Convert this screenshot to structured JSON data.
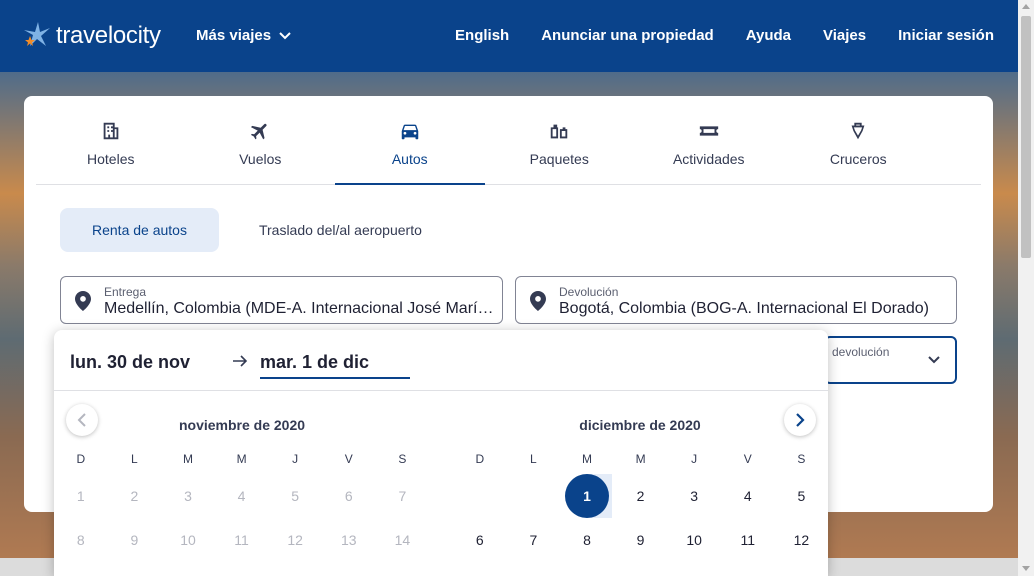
{
  "header": {
    "logo_text": "travelocity",
    "more_trips": "Más viajes",
    "nav": [
      "English",
      "Anunciar una propiedad",
      "Ayuda",
      "Viajes",
      "Iniciar sesión"
    ]
  },
  "tabs": [
    {
      "label": "Hoteles",
      "icon": "building-icon"
    },
    {
      "label": "Vuelos",
      "icon": "plane-icon"
    },
    {
      "label": "Autos",
      "icon": "car-icon",
      "active": true
    },
    {
      "label": "Paquetes",
      "icon": "luggage-icon"
    },
    {
      "label": "Actividades",
      "icon": "ticket-icon"
    },
    {
      "label": "Cruceros",
      "icon": "ship-icon"
    }
  ],
  "subtabs": {
    "rental": "Renta de autos",
    "transfer": "Traslado del/al aeropuerto"
  },
  "pickup": {
    "label": "Entrega",
    "value": "Medellín, Colombia (MDE-A. Internacional José María Córdova)"
  },
  "dropoff": {
    "label": "Devolución",
    "value": "Bogotá, Colombia (BOG-A. Internacional El Dorado)"
  },
  "return_time": {
    "label": "devolución"
  },
  "calendar": {
    "start_date": "lun. 30 de nov",
    "end_date": "mar. 1 de dic",
    "months": [
      {
        "title": "noviembre de 2020",
        "weekdays": [
          "D",
          "L",
          "M",
          "M",
          "J",
          "V",
          "S"
        ],
        "days": [
          "1",
          "2",
          "3",
          "4",
          "5",
          "6",
          "7",
          "8",
          "9",
          "10",
          "11",
          "12",
          "13",
          "14"
        ],
        "disabled": true
      },
      {
        "title": "diciembre de 2020",
        "weekdays": [
          "D",
          "L",
          "M",
          "M",
          "J",
          "V",
          "S"
        ],
        "leading_blanks": 2,
        "days": [
          "1",
          "2",
          "3",
          "4",
          "5",
          "6",
          "7",
          "8",
          "9",
          "10",
          "11",
          "12"
        ],
        "selected": "1"
      }
    ]
  },
  "colors": {
    "brand": "#0a438b",
    "selected_range": "#e4ecf8"
  }
}
